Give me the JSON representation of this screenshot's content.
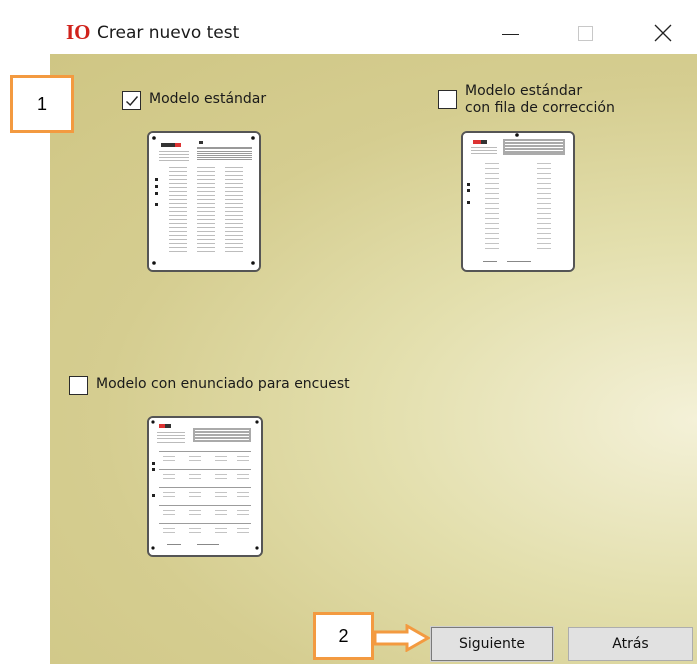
{
  "window": {
    "logo": "IO",
    "title": "Crear nuevo test",
    "controls": [
      "minimize-icon",
      "maximize-icon",
      "close-icon"
    ]
  },
  "callouts": {
    "first": "1",
    "second": "2"
  },
  "options": {
    "standard": {
      "label": "Modelo estándar",
      "checked": true
    },
    "correction": {
      "label": "Modelo estándar\ncon fila de corrección",
      "checked": false
    },
    "survey": {
      "label": "Modelo con enunciado para encuest",
      "checked": false
    }
  },
  "buttons": {
    "next": "Siguiente",
    "back": "Atrás"
  },
  "colors": {
    "logo": "#d0221b",
    "callout_border": "#f39a40",
    "background_gradient": "#d5cd90"
  }
}
